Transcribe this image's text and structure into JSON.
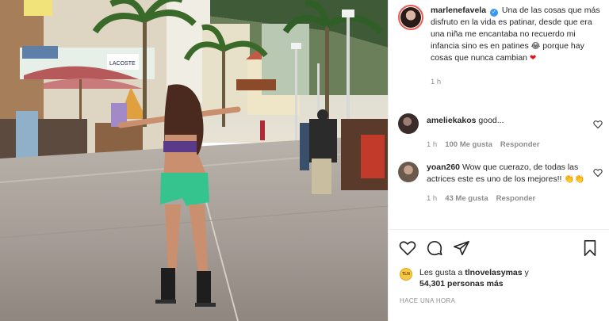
{
  "post": {
    "username": "marlenefavela",
    "caption_pre": "Una de las cosas que más disfruto en la vida es patinar, desde que era una niña me encantaba no recuerdo mi infancia sino es en patines",
    "caption_emoji_1": "😂",
    "caption_post": "porque hay cosas que nunca cambian",
    "caption_emoji_2": "❤",
    "time": "1 h"
  },
  "comments": [
    {
      "username": "ameliekakos",
      "text": "good...",
      "time": "1 h",
      "likes": "100 Me gusta",
      "reply": "Responder"
    },
    {
      "username": "yoan260",
      "text": "Wow que cuerazo, de todas las actrices este es uno de los mejores!!",
      "emojis": "👏👏",
      "time": "1 h",
      "likes": "43 Me gusta",
      "reply": "Responder"
    }
  ],
  "likes_summary": {
    "prefix": "Les gusta a",
    "liker": "tlnovelasymas",
    "mid": "y",
    "count": "54,301 personas más"
  },
  "timestamp": "HACE UNA HORA",
  "photo_sign": "LACOSTE",
  "colors": {
    "verified": "#3897f0",
    "heart": "#e0161d",
    "muted": "#8e8e8e"
  }
}
